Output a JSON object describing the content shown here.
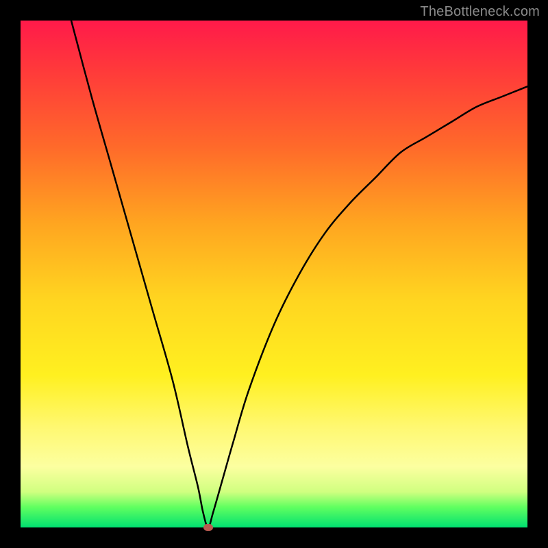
{
  "watermark": "TheBottleneck.com",
  "colors": {
    "marker": "#b85a50",
    "curve": "#000000"
  },
  "chart_data": {
    "type": "line",
    "title": "",
    "xlabel": "",
    "ylabel": "",
    "xlim": [
      0,
      100
    ],
    "ylim": [
      0,
      100
    ],
    "grid": false,
    "legend": false,
    "annotations": [],
    "marker_point": {
      "x": 37,
      "y": 0
    },
    "series": [
      {
        "name": "bottleneck-curve",
        "x": [
          10,
          14,
          18,
          22,
          26,
          30,
          33,
          35,
          36,
          37,
          38,
          40,
          42,
          45,
          50,
          55,
          60,
          65,
          70,
          75,
          80,
          85,
          90,
          95,
          100
        ],
        "values": [
          100,
          85,
          71,
          57,
          43,
          29,
          16,
          8,
          3,
          0,
          3,
          10,
          17,
          27,
          40,
          50,
          58,
          64,
          69,
          74,
          77,
          80,
          83,
          85,
          87
        ]
      }
    ]
  }
}
